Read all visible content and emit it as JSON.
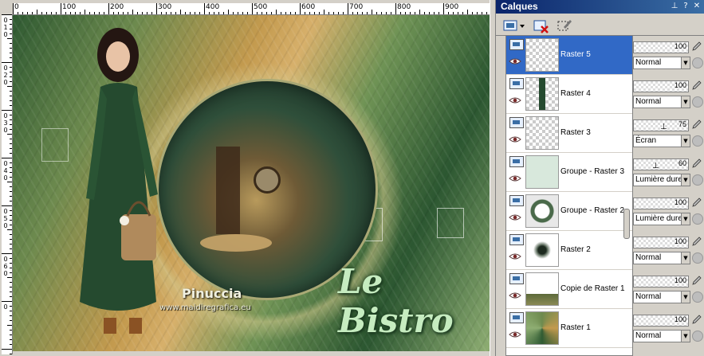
{
  "ruler": {
    "top_labels": [
      "0",
      "100",
      "200",
      "300",
      "400",
      "500",
      "600",
      "700",
      "800",
      "900"
    ],
    "left_labels": [
      "0",
      "1",
      "0",
      "0",
      "2",
      "0",
      "0",
      "3",
      "0",
      "0",
      "4",
      "0",
      "0",
      "5",
      "0",
      "0",
      "6",
      "0",
      "0"
    ]
  },
  "artwork": {
    "signature": "Pinuccia",
    "website": "www.maidiregrafica.eu",
    "title": "Le Bistro"
  },
  "panel": {
    "title": "Calques",
    "titlebar_buttons": [
      "pin-icon",
      "help-icon",
      "close-icon"
    ],
    "toolbar": [
      {
        "name": "new-raster-layer-icon",
        "has_dropdown": true
      },
      {
        "name": "delete-layer-icon"
      },
      {
        "name": "edit-selection-icon"
      }
    ],
    "layers": [
      {
        "name": "Raster 5",
        "opacity": "100",
        "blend": "Normal",
        "selected": true,
        "thumb": "empty"
      },
      {
        "name": "Raster 4",
        "opacity": "100",
        "blend": "Normal",
        "selected": false,
        "thumb": "woman"
      },
      {
        "name": "Raster 3",
        "opacity": "75",
        "blend": "Écran",
        "selected": false,
        "thumb": "empty"
      },
      {
        "name": "Groupe - Raster 3",
        "opacity": "60",
        "blend": "Lumière dure",
        "selected": false,
        "thumb": "pattern"
      },
      {
        "name": "Groupe - Raster 2",
        "opacity": "100",
        "blend": "Lumière dure",
        "selected": false,
        "thumb": "ring"
      },
      {
        "name": "Raster 2",
        "opacity": "100",
        "blend": "Normal",
        "selected": false,
        "thumb": "dot"
      },
      {
        "name": "Copie de Raster 1",
        "opacity": "100",
        "blend": "Normal",
        "selected": false,
        "thumb": "strip"
      },
      {
        "name": "Raster 1",
        "opacity": "100",
        "blend": "Normal",
        "selected": false,
        "thumb": "full"
      }
    ]
  }
}
